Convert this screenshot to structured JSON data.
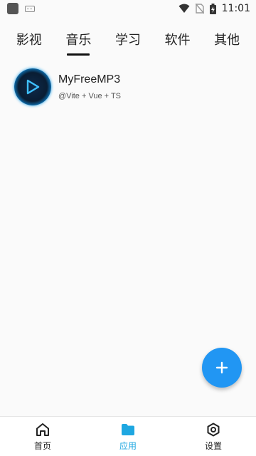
{
  "status_bar": {
    "time": "11:01",
    "icons": [
      "app-icon",
      "keyboard-icon",
      "wifi-icon",
      "no-sim-icon",
      "battery-charging-icon"
    ]
  },
  "tabs": [
    {
      "label": "影视"
    },
    {
      "label": "音乐",
      "active": true
    },
    {
      "label": "学习"
    },
    {
      "label": "软件"
    },
    {
      "label": "其他"
    }
  ],
  "apps": [
    {
      "name": "MyFreeMP3",
      "subtitle": "@Vite + Vue + TS",
      "icon": "play-icon"
    }
  ],
  "fab": {
    "icon": "plus-icon",
    "color": "#2196f3"
  },
  "bottom_nav": [
    {
      "label": "首页",
      "icon": "home-icon"
    },
    {
      "label": "应用",
      "icon": "folder-icon",
      "active": true
    },
    {
      "label": "设置",
      "icon": "settings-hexagon-icon"
    }
  ],
  "colors": {
    "accent": "#1ea7e1",
    "fab": "#2196f3"
  }
}
